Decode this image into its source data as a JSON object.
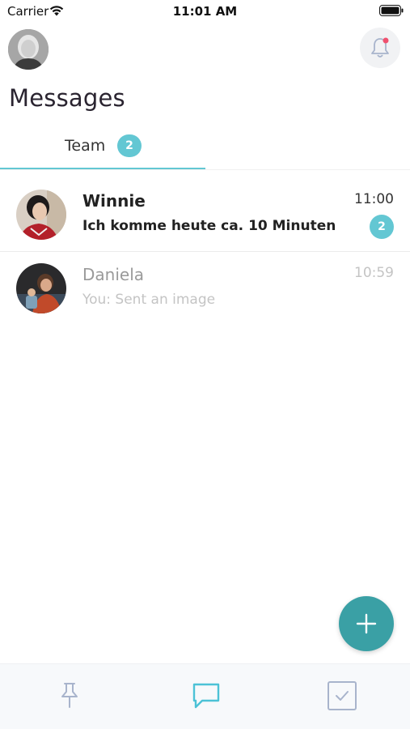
{
  "status_bar": {
    "carrier": "Carrier",
    "time": "11:01 AM"
  },
  "header": {
    "title": "Messages"
  },
  "tabs": [
    {
      "label": "Team",
      "badge": "2",
      "active": true
    }
  ],
  "conversations": [
    {
      "name": "Winnie",
      "preview": "Ich komme heute ca. 10 Minuten ...",
      "time": "11:00",
      "unread_count": "2"
    },
    {
      "name": "Daniela",
      "preview": "You: Sent an image",
      "time": "10:59"
    }
  ],
  "bottom_tabs": [
    {
      "icon": "pin-icon",
      "active": false
    },
    {
      "icon": "chat-bubble-icon",
      "active": true
    },
    {
      "icon": "checkbox-icon",
      "active": false
    }
  ],
  "colors": {
    "accent": "#63c7d3",
    "fab": "#3aa0a5",
    "notification_dot": "#f0506e",
    "inactive_icon": "#a8b4cc"
  },
  "icons": {
    "header_right": "bell-icon",
    "fab": "plus-icon"
  }
}
